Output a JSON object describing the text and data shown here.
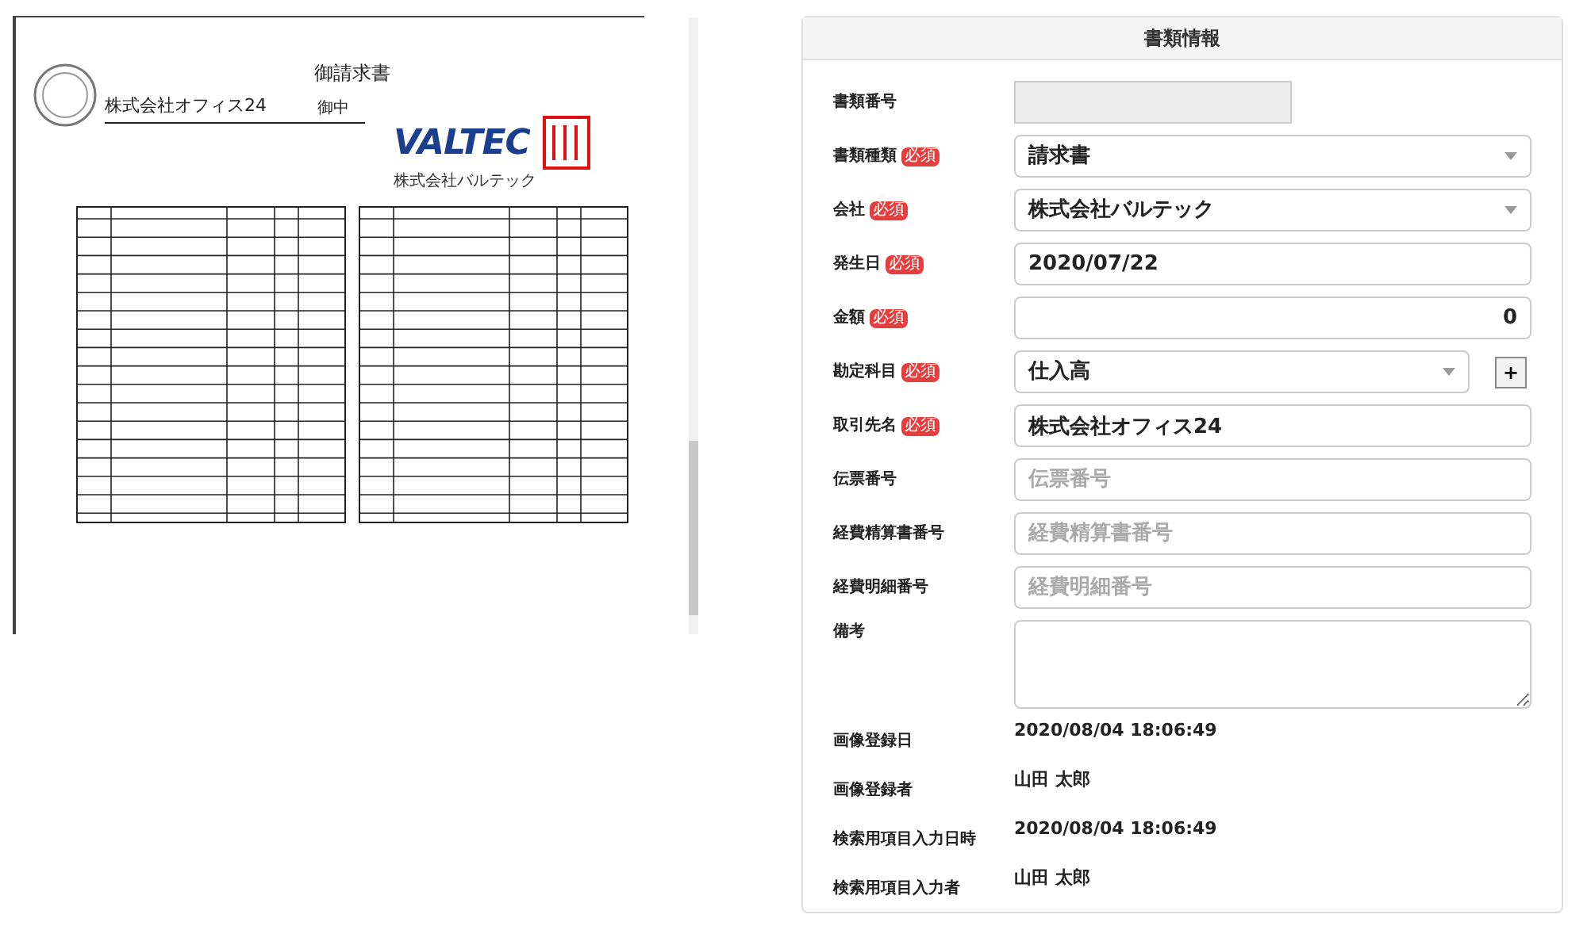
{
  "document_viewer": {
    "title": "御請求書",
    "addressee": "株式会社オフィス24",
    "honorific": "御中",
    "logo": "VALTEC",
    "issuer": "株式会社バルテック"
  },
  "form": {
    "title": "書類情報",
    "fields": [
      {
        "label": "書類番号",
        "kind": "readonly"
      },
      {
        "label": "書類種類",
        "badge": "必須",
        "kind": "select",
        "value": "請求書"
      },
      {
        "label": "会社",
        "badge": "必須",
        "kind": "select",
        "value": "株式会社バルテック"
      },
      {
        "label": "発生日",
        "badge": "必須",
        "kind": "input",
        "value": "2020/07/22"
      },
      {
        "label": "金額",
        "badge": "必須",
        "kind": "number",
        "value": "0"
      },
      {
        "label": "勘定科目",
        "badge": "必須",
        "kind": "select",
        "value": "仕入高",
        "add_button": "+"
      },
      {
        "label": "取引先名",
        "badge": "必須",
        "kind": "input",
        "value": "株式会社オフィス24"
      },
      {
        "label": "伝票番号",
        "kind": "input",
        "placeholder": "伝票番号"
      },
      {
        "label": "経費精算書番号",
        "kind": "input",
        "placeholder": "経費精算書番号"
      },
      {
        "label": "経費明細番号",
        "kind": "input",
        "placeholder": "経費明細番号"
      },
      {
        "label": "備考",
        "kind": "textarea"
      },
      {
        "label": "画像登録日",
        "kind": "static",
        "value": "2020/08/04 18:06:49"
      },
      {
        "label": "画像登録者",
        "kind": "static",
        "value": "山田 太郎"
      },
      {
        "label": "検索用項目入力日時",
        "kind": "static",
        "value": "2020/08/04 18:06:49"
      },
      {
        "label": "検索用項目入力者",
        "kind": "static",
        "value": "山田 太郎"
      }
    ]
  }
}
